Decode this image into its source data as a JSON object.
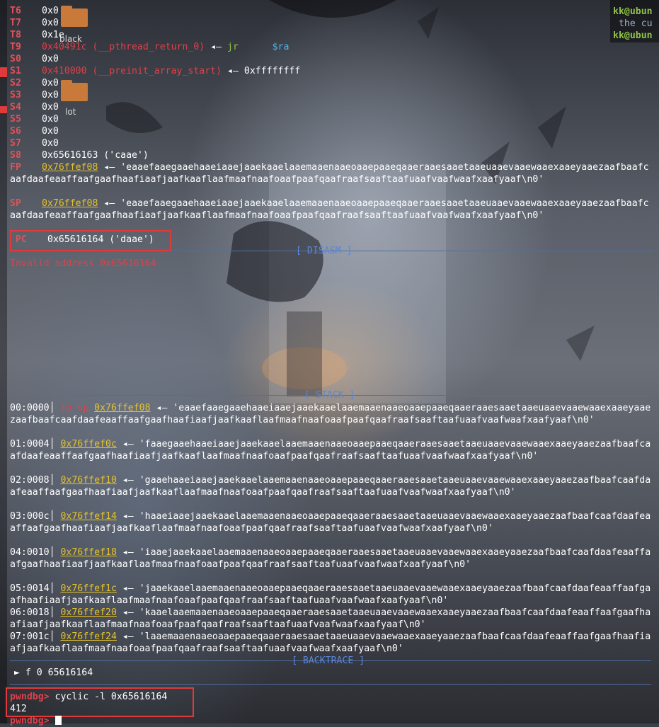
{
  "colors": {
    "register": "#e0525a",
    "address": "#e6c22a",
    "error": "#e0404a",
    "section": "#5b86d8",
    "highlight_box": "#e03a3a"
  },
  "desktop_icons": [
    {
      "label": "black"
    },
    {
      "label": "lot"
    }
  ],
  "right_panel": {
    "line1": "kk@ubun",
    "line2": " the cu",
    "line3": "kk@ubun"
  },
  "registers": {
    "T6": {
      "name": "T6",
      "value": "0x0"
    },
    "T7": {
      "name": "T7",
      "value": "0x0"
    },
    "T8": {
      "name": "T8",
      "value": "0x1e"
    },
    "T9": {
      "name": "T9",
      "value": "0x40491c (__pthread_return_0)",
      "arrow": "◂—",
      "instr": "jr",
      "operand": "$ra"
    },
    "S0": {
      "name": "S0",
      "value": "0x0"
    },
    "S1": {
      "name": "S1",
      "value": "0x410000 (__preinit_array_start)",
      "arrow": "◂—",
      "deref": "0xffffffff"
    },
    "S2": {
      "name": "S2",
      "value": "0x0"
    },
    "S3": {
      "name": "S3",
      "value": "0x0"
    },
    "S4": {
      "name": "S4",
      "value": "0x0"
    },
    "S5": {
      "name": "S5",
      "value": "0x0"
    },
    "S6": {
      "name": "S6",
      "value": "0x0"
    },
    "S7": {
      "name": "S7",
      "value": "0x0"
    },
    "S8": {
      "name": "S8",
      "value": "0x65616163 ('caae')"
    },
    "FP": {
      "name": "FP",
      "addr": "0x76ffef08",
      "arrow": "◂—",
      "str": "'eaaefaaegaaehaaeiaaejaaekaaelaaemaaenaaeoaaepaaeqaaeraaesaaetaaeuaaevaaewaaexaaeyaaezaafbaafcaafdaafeaaffaafgaafhaafiaafjaafkaaflaafmaafnaafoaafpaafqaafraafsaaftaafuaafvaafwaafxaafyaaf\\n0'"
    },
    "SP": {
      "name": "SP",
      "addr": "0x76ffef08",
      "arrow": "◂—",
      "str": "'eaaefaaegaaehaaeiaaejaaekaaelaaemaaenaaeoaaepaaeqaaeraaesaaetaaeuaaevaaewaaexaaeyaaezaafbaafcaafdaafeaaffaafgaafhaafiaafjaafkaaflaafmaafnaafoaafpaafqaafraafsaaftaafuaafvaafwaafxaafyaaf\\n0'"
    },
    "PC": {
      "name": "PC",
      "value": "0x65616164 ('daae')"
    }
  },
  "disasm": {
    "title": "[ DISASM ]",
    "error": "Invalid address 0x65616164"
  },
  "stack": {
    "title": "[ STACK ]",
    "rows": [
      {
        "offset": "00:0000│",
        "regs": "fp sp",
        "addr": "0x76ffef08",
        "arrow": "◂—",
        "str": "'eaaefaaegaaehaaeiaaejaaekaaelaaemaaenaaeoaaepaaeqaaeraaesaaetaaeuaaevaaewaaexaaeyaaezaafbaafcaafdaafeaaffaafgaafhaafiaafjaafkaaflaafmaafnaafoaafpaafqaafraafsaaftaafuaafvaafwaafxaafyaaf\\n0'"
      },
      {
        "offset": "01:0004│",
        "regs": "",
        "addr": "0x76ffef0c",
        "arrow": "◂—",
        "str": "'faaegaaehaaeiaaejaaekaaelaaemaaenaaeoaaepaaeqaaeraaesaaetaaeuaaevaaewaaexaaeyaaezaafbaafcaafdaafeaaffaafgaafhaafiaafjaafkaaflaafmaafnaafoaafpaafqaafraafsaaftaafuaafvaafwaafxaafyaaf\\n0'"
      },
      {
        "offset": "02:0008│",
        "regs": "",
        "addr": "0x76ffef10",
        "arrow": "◂—",
        "str": "'gaaehaaeiaaejaaekaaelaaemaaenaaeoaaepaaeqaaeraaesaaetaaeuaaevaaewaaexaaeyaaezaafbaafcaafdaafeaaffaafgaafhaafiaafjaafkaaflaafmaafnaafoaafpaafqaafraafsaaftaafuaafvaafwaafxaafyaaf\\n0'"
      },
      {
        "offset": "03:000c│",
        "regs": "",
        "addr": "0x76ffef14",
        "arrow": "◂—",
        "str": "'haaeiaaejaaekaaelaaemaaenaaeoaaepaaeqaaeraaesaaetaaeuaaevaaewaaexaaeyaaezaafbaafcaafdaafeaaffaafgaafhaafiaafjaafkaaflaafmaafnaafoaafpaafqaafraafsaaftaafuaafvaafwaafxaafyaaf\\n0'"
      },
      {
        "offset": "04:0010│",
        "regs": "",
        "addr": "0x76ffef18",
        "arrow": "◂—",
        "str": "'iaaejaaekaaelaaemaaenaaeoaaepaaeqaaeraaesaaetaaeuaaevaaewaaexaaeyaaezaafbaafcaafdaafeaaffaafgaafhaafiaafjaafkaaflaafmaafnaafoaafpaafqaafraafsaaftaafuaafvaafwaafxaafyaaf\\n0'"
      },
      {
        "offset": "05:0014│",
        "regs": "",
        "addr": "0x76ffef1c",
        "arrow": "◂—",
        "str": "'jaaekaaelaaemaaenaaeoaaepaaeqaaeraaesaaetaaeuaaevaaewaaexaaeyaaezaafbaafcaafdaafeaaffaafgaafhaafiaafjaafkaaflaafmaafnaafoaafpaafqaafraafsaaftaafuaafvaafwaafxaafyaaf\\n0'"
      },
      {
        "offset": "06:0018│",
        "regs": "",
        "addr": "0x76ffef20",
        "arrow": "◂—",
        "str": "'kaaelaaemaaenaaeoaaepaaeqaaeraaesaaetaaeuaaevaaewaaexaaeyaaezaafbaafcaafdaafeaaffaafgaafhaafiaafjaafkaaflaafmaafnaafoaafpaafqaafraafsaaftaafuaafvaafwaafxaafyaaf\\n0'"
      },
      {
        "offset": "07:001c│",
        "regs": "",
        "addr": "0x76ffef24",
        "arrow": "◂—",
        "str": "'laaemaaenaaeoaaepaaeqaaeraaesaaetaaeuaaevaaewaaexaaeyaaezaafbaafcaafdaafeaaffaafgaafhaafiaafjaafkaaflaafmaafnaafoaafpaafqaafraafsaaftaafuaafvaafwaafxaafyaaf\\n0'"
      }
    ]
  },
  "backtrace": {
    "title": "[ BACKTRACE ]",
    "frames": [
      {
        "marker": "►",
        "text": "f 0 65616164"
      }
    ]
  },
  "prompt": {
    "label": "pwndbg>",
    "command": "cyclic -l 0x65616164",
    "output": "412",
    "label2": "pwndbg>"
  }
}
